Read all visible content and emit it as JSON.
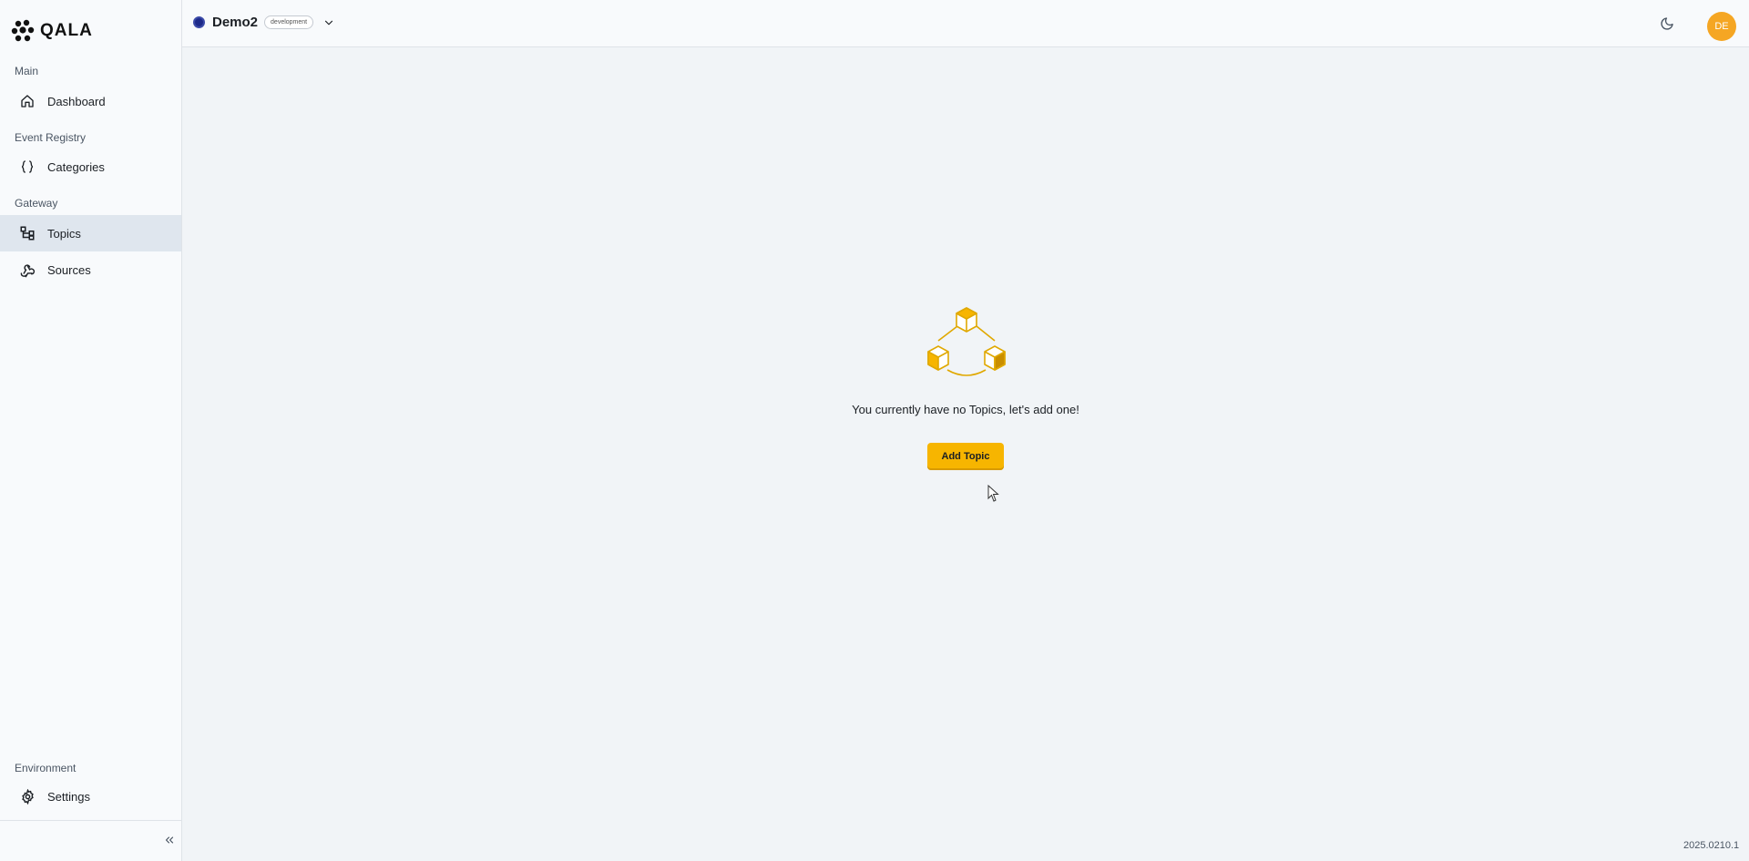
{
  "app": {
    "logo_text": "QALA"
  },
  "sidebar": {
    "sections": [
      {
        "label": "Main"
      },
      {
        "label": "Event Registry"
      },
      {
        "label": "Gateway"
      },
      {
        "label": "Environment"
      }
    ],
    "items": [
      {
        "label": "Dashboard",
        "icon": "home-icon"
      },
      {
        "label": "Categories",
        "icon": "braces-icon"
      },
      {
        "label": "Topics",
        "icon": "topics-icon",
        "active": true
      },
      {
        "label": "Sources",
        "icon": "webhook-icon"
      },
      {
        "label": "Settings",
        "icon": "gear-icon"
      }
    ],
    "collapse_icon": "double-chevron-left-icon"
  },
  "header": {
    "environment": {
      "name": "Demo2",
      "badge": "development",
      "color": "#1e2a8a"
    },
    "theme_icon": "moon-icon",
    "avatar_initials": "DE",
    "avatar_color": "#f5a623"
  },
  "main": {
    "empty_message": "You currently have no Topics, let's add one!",
    "add_button_label": "Add Topic",
    "illustration_icon": "cubes-icon",
    "accent_color": "#f7b500"
  },
  "footer": {
    "version": "2025.0210.1"
  }
}
